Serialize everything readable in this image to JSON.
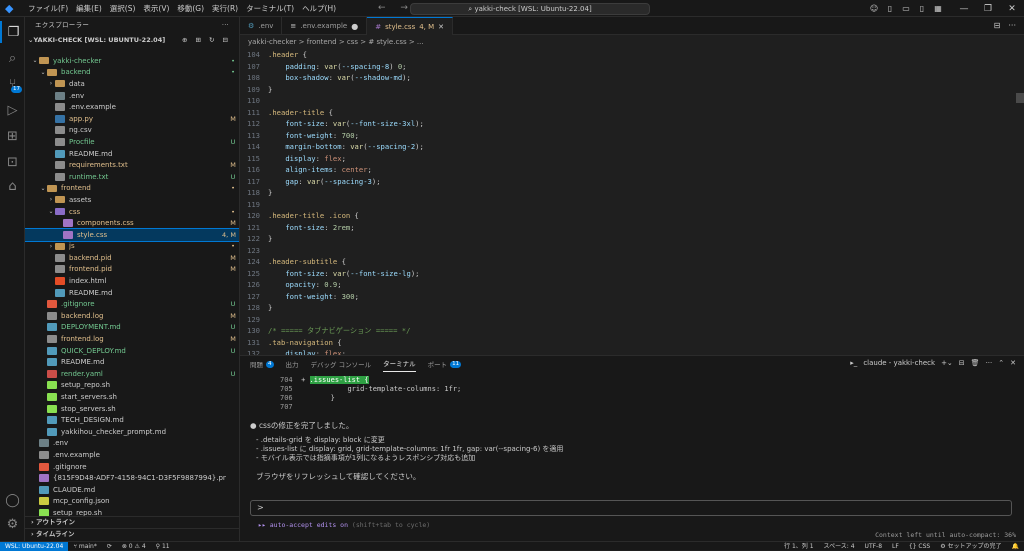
{
  "titlebar": {
    "menu": [
      "ファイル(F)",
      "編集(E)",
      "選択(S)",
      "表示(V)",
      "移動(G)",
      "実行(R)",
      "ターミナル(T)",
      "ヘルプ(H)"
    ],
    "command_center": "yakki-check [WSL: Ubuntu-22.04]"
  },
  "activity_bar": {
    "scm_badge": "17"
  },
  "sidebar": {
    "title": "エクスプローラー",
    "root": "YAKKI-CHECK [WSL: UBUNTU-22.04]",
    "tree": [
      {
        "name": "yakki-checker",
        "depth": 0,
        "chevron": "v",
        "icon": "folder",
        "status": "•",
        "cls": "green"
      },
      {
        "name": "backend",
        "depth": 1,
        "chevron": "v",
        "icon": "folder",
        "status": "•",
        "cls": "green"
      },
      {
        "name": "data",
        "depth": 2,
        "chevron": ">",
        "icon": "folder",
        "status": "",
        "cls": ""
      },
      {
        "name": ".env",
        "depth": 2,
        "chevron": "",
        "icon": "gear",
        "status": "",
        "cls": ""
      },
      {
        "name": ".env.example",
        "depth": 2,
        "chevron": "",
        "icon": "file",
        "status": "",
        "cls": ""
      },
      {
        "name": "app.py",
        "depth": 2,
        "chevron": "",
        "icon": "py",
        "status": "M",
        "cls": "yellow"
      },
      {
        "name": "ng.csv",
        "depth": 2,
        "chevron": "",
        "icon": "file",
        "status": "",
        "cls": ""
      },
      {
        "name": "Procfile",
        "depth": 2,
        "chevron": "",
        "icon": "file",
        "status": "U",
        "cls": "green"
      },
      {
        "name": "README.md",
        "depth": 2,
        "chevron": "",
        "icon": "md",
        "status": "",
        "cls": ""
      },
      {
        "name": "requirements.txt",
        "depth": 2,
        "chevron": "",
        "icon": "txt",
        "status": "M",
        "cls": "yellow"
      },
      {
        "name": "runtime.txt",
        "depth": 2,
        "chevron": "",
        "icon": "txt",
        "status": "U",
        "cls": "green"
      },
      {
        "name": "frontend",
        "depth": 1,
        "chevron": "v",
        "icon": "folder",
        "status": "•",
        "cls": "yellow"
      },
      {
        "name": "assets",
        "depth": 2,
        "chevron": ">",
        "icon": "folder",
        "status": "",
        "cls": ""
      },
      {
        "name": "css",
        "depth": 2,
        "chevron": "v",
        "icon": "folder-css",
        "status": "•",
        "cls": "yellow"
      },
      {
        "name": "components.css",
        "depth": 3,
        "chevron": "",
        "icon": "css",
        "status": "M",
        "cls": "yellow"
      },
      {
        "name": "style.css",
        "depth": 3,
        "chevron": "",
        "icon": "css",
        "status": "4, M",
        "cls": "yellow",
        "selected": true
      },
      {
        "name": "js",
        "depth": 2,
        "chevron": ">",
        "icon": "folder",
        "status": "•",
        "cls": "yellow"
      },
      {
        "name": "backend.pid",
        "depth": 2,
        "chevron": "",
        "icon": "file",
        "status": "M",
        "cls": "yellow"
      },
      {
        "name": "frontend.pid",
        "depth": 2,
        "chevron": "",
        "icon": "file",
        "status": "M",
        "cls": "yellow"
      },
      {
        "name": "index.html",
        "depth": 2,
        "chevron": "",
        "icon": "html",
        "status": "",
        "cls": ""
      },
      {
        "name": "README.md",
        "depth": 2,
        "chevron": "",
        "icon": "md",
        "status": "",
        "cls": ""
      },
      {
        "name": ".gitignore",
        "depth": 1,
        "chevron": "",
        "icon": "git",
        "status": "U",
        "cls": "green"
      },
      {
        "name": "backend.log",
        "depth": 1,
        "chevron": "",
        "icon": "log",
        "status": "M",
        "cls": "yellow"
      },
      {
        "name": "DEPLOYMENT.md",
        "depth": 1,
        "chevron": "",
        "icon": "md",
        "status": "U",
        "cls": "green"
      },
      {
        "name": "frontend.log",
        "depth": 1,
        "chevron": "",
        "icon": "log",
        "status": "M",
        "cls": "yellow"
      },
      {
        "name": "QUICK_DEPLOY.md",
        "depth": 1,
        "chevron": "",
        "icon": "md",
        "status": "U",
        "cls": "green"
      },
      {
        "name": "README.md",
        "depth": 1,
        "chevron": "",
        "icon": "md",
        "status": "",
        "cls": ""
      },
      {
        "name": "render.yaml",
        "depth": 1,
        "chevron": "",
        "icon": "yaml",
        "status": "U",
        "cls": "green"
      },
      {
        "name": "setup_repo.sh",
        "depth": 1,
        "chevron": "",
        "icon": "sh",
        "status": "",
        "cls": ""
      },
      {
        "name": "start_servers.sh",
        "depth": 1,
        "chevron": "",
        "icon": "sh",
        "status": "",
        "cls": ""
      },
      {
        "name": "stop_servers.sh",
        "depth": 1,
        "chevron": "",
        "icon": "sh",
        "status": "",
        "cls": ""
      },
      {
        "name": "TECH_DESIGN.md",
        "depth": 1,
        "chevron": "",
        "icon": "md",
        "status": "",
        "cls": ""
      },
      {
        "name": "yakkihou_checker_prompt.md",
        "depth": 1,
        "chevron": "",
        "icon": "md",
        "status": "",
        "cls": ""
      },
      {
        "name": ".env",
        "depth": 0,
        "chevron": "",
        "icon": "gear",
        "status": "",
        "cls": ""
      },
      {
        "name": ".env.example",
        "depth": 0,
        "chevron": "",
        "icon": "file",
        "status": "",
        "cls": ""
      },
      {
        "name": ".gitignore",
        "depth": 0,
        "chevron": "",
        "icon": "git",
        "status": "",
        "cls": ""
      },
      {
        "name": "{815F9D48-ADF7-4158-94C1-D3F5F9887994}.png",
        "depth": 0,
        "chevron": "",
        "icon": "img",
        "status": "",
        "cls": ""
      },
      {
        "name": "CLAUDE.md",
        "depth": 0,
        "chevron": "",
        "icon": "md",
        "status": "",
        "cls": ""
      },
      {
        "name": "mcp_config.json",
        "depth": 0,
        "chevron": "",
        "icon": "json",
        "status": "",
        "cls": ""
      },
      {
        "name": "setup_repo.sh",
        "depth": 0,
        "chevron": "",
        "icon": "sh",
        "status": "",
        "cls": ""
      }
    ],
    "outline_label": "アウトライン",
    "timeline_label": "タイムライン"
  },
  "tabs": [
    {
      "label": ".env",
      "icon": "⚙",
      "active": false,
      "mod": "",
      "cls": ""
    },
    {
      "label": ".env.example",
      "icon": "≡",
      "active": false,
      "mod": "●",
      "cls": ""
    },
    {
      "label": "style.css",
      "badge": "4, M",
      "icon": "#",
      "active": true,
      "mod": "",
      "cls": ""
    }
  ],
  "breadcrumb": "yakki-checker > frontend > css > # style.css > ...",
  "code_lines": [
    {
      "n": "104",
      "t": [
        [
          "sel-c",
          ".header"
        ],
        [
          "pun",
          " {"
        ]
      ]
    },
    {
      "n": "107",
      "t": [
        [
          "pun",
          "    "
        ],
        [
          "prop",
          "padding"
        ],
        [
          "pun",
          ": "
        ],
        [
          "fn",
          "var"
        ],
        [
          "pun",
          "("
        ],
        [
          "var",
          "--spacing-8"
        ],
        [
          "pun",
          ") "
        ],
        [
          "num",
          "0"
        ],
        [
          "pun",
          ";"
        ]
      ]
    },
    {
      "n": "108",
      "t": [
        [
          "pun",
          "    "
        ],
        [
          "prop",
          "box-shadow"
        ],
        [
          "pun",
          ": "
        ],
        [
          "fn",
          "var"
        ],
        [
          "pun",
          "("
        ],
        [
          "var",
          "--shadow-md"
        ],
        [
          "pun",
          ");"
        ]
      ]
    },
    {
      "n": "109",
      "t": [
        [
          "pun",
          "}"
        ]
      ]
    },
    {
      "n": "110",
      "t": []
    },
    {
      "n": "111",
      "t": [
        [
          "sel-c",
          ".header-title"
        ],
        [
          "pun",
          " {"
        ]
      ]
    },
    {
      "n": "112",
      "t": [
        [
          "pun",
          "    "
        ],
        [
          "prop",
          "font-size"
        ],
        [
          "pun",
          ": "
        ],
        [
          "fn",
          "var"
        ],
        [
          "pun",
          "("
        ],
        [
          "var",
          "--font-size-3xl"
        ],
        [
          "pun",
          ");"
        ]
      ]
    },
    {
      "n": "113",
      "t": [
        [
          "pun",
          "    "
        ],
        [
          "prop",
          "font-weight"
        ],
        [
          "pun",
          ": "
        ],
        [
          "num",
          "700"
        ],
        [
          "pun",
          ";"
        ]
      ]
    },
    {
      "n": "114",
      "t": [
        [
          "pun",
          "    "
        ],
        [
          "prop",
          "margin-bottom"
        ],
        [
          "pun",
          ": "
        ],
        [
          "fn",
          "var"
        ],
        [
          "pun",
          "("
        ],
        [
          "var",
          "--spacing-2"
        ],
        [
          "pun",
          ");"
        ]
      ]
    },
    {
      "n": "115",
      "t": [
        [
          "pun",
          "    "
        ],
        [
          "prop",
          "display"
        ],
        [
          "pun",
          ": "
        ],
        [
          "val",
          "flex"
        ],
        [
          "pun",
          ";"
        ]
      ]
    },
    {
      "n": "116",
      "t": [
        [
          "pun",
          "    "
        ],
        [
          "prop",
          "align-items"
        ],
        [
          "pun",
          ": "
        ],
        [
          "val",
          "center"
        ],
        [
          "pun",
          ";"
        ]
      ]
    },
    {
      "n": "117",
      "t": [
        [
          "pun",
          "    "
        ],
        [
          "prop",
          "gap"
        ],
        [
          "pun",
          ": "
        ],
        [
          "fn",
          "var"
        ],
        [
          "pun",
          "("
        ],
        [
          "var",
          "--spacing-3"
        ],
        [
          "pun",
          ");"
        ]
      ]
    },
    {
      "n": "118",
      "t": [
        [
          "pun",
          "}"
        ]
      ]
    },
    {
      "n": "119",
      "t": []
    },
    {
      "n": "120",
      "t": [
        [
          "sel-c",
          ".header-title .icon"
        ],
        [
          "pun",
          " {"
        ]
      ]
    },
    {
      "n": "121",
      "t": [
        [
          "pun",
          "    "
        ],
        [
          "prop",
          "font-size"
        ],
        [
          "pun",
          ": "
        ],
        [
          "num",
          "2rem"
        ],
        [
          "pun",
          ";"
        ]
      ]
    },
    {
      "n": "122",
      "t": [
        [
          "pun",
          "}"
        ]
      ]
    },
    {
      "n": "123",
      "t": []
    },
    {
      "n": "124",
      "t": [
        [
          "sel-c",
          ".header-subtitle"
        ],
        [
          "pun",
          " {"
        ]
      ]
    },
    {
      "n": "125",
      "t": [
        [
          "pun",
          "    "
        ],
        [
          "prop",
          "font-size"
        ],
        [
          "pun",
          ": "
        ],
        [
          "fn",
          "var"
        ],
        [
          "pun",
          "("
        ],
        [
          "var",
          "--font-size-lg"
        ],
        [
          "pun",
          ");"
        ]
      ]
    },
    {
      "n": "126",
      "t": [
        [
          "pun",
          "    "
        ],
        [
          "prop",
          "opacity"
        ],
        [
          "pun",
          ": "
        ],
        [
          "num",
          "0.9"
        ],
        [
          "pun",
          ";"
        ]
      ]
    },
    {
      "n": "127",
      "t": [
        [
          "pun",
          "    "
        ],
        [
          "prop",
          "font-weight"
        ],
        [
          "pun",
          ": "
        ],
        [
          "num",
          "300"
        ],
        [
          "pun",
          ";"
        ]
      ]
    },
    {
      "n": "128",
      "t": [
        [
          "pun",
          "}"
        ]
      ]
    },
    {
      "n": "129",
      "t": []
    },
    {
      "n": "130",
      "t": [
        [
          "cm",
          "/* ===== タブナビゲーション ===== */"
        ]
      ]
    },
    {
      "n": "131",
      "t": [
        [
          "sel-c",
          ".tab-navigation"
        ],
        [
          "pun",
          " {"
        ]
      ]
    },
    {
      "n": "132",
      "t": [
        [
          "pun",
          "    "
        ],
        [
          "prop",
          "display"
        ],
        [
          "pun",
          ": "
        ],
        [
          "val",
          "flex"
        ],
        [
          "pun",
          ";"
        ]
      ]
    },
    {
      "n": "133",
      "t": [
        [
          "pun",
          "    "
        ],
        [
          "prop",
          "gap"
        ],
        [
          "pun",
          ": "
        ],
        [
          "fn",
          "var"
        ],
        [
          "pun",
          "("
        ],
        [
          "var",
          "--spacing-1"
        ],
        [
          "pun",
          ");"
        ]
      ]
    },
    {
      "n": "134",
      "t": [
        [
          "pun",
          "    "
        ],
        [
          "prop",
          "margin-bottom"
        ],
        [
          "pun",
          ": "
        ],
        [
          "fn",
          "var"
        ],
        [
          "pun",
          "("
        ],
        [
          "var",
          "--spacing-6"
        ],
        [
          "pun",
          ");"
        ]
      ]
    },
    {
      "n": "135",
      "t": [
        [
          "pun",
          "    "
        ],
        [
          "prop",
          "background-color"
        ],
        [
          "pun",
          ": "
        ],
        [
          "pun",
          "□"
        ],
        [
          "val",
          "white"
        ],
        [
          "pun",
          ";"
        ]
      ]
    }
  ],
  "panel": {
    "tabs": [
      {
        "label": "問題",
        "badge": "4"
      },
      {
        "label": "出力",
        "badge": ""
      },
      {
        "label": "デバッグ コンソール",
        "badge": ""
      },
      {
        "label": "ターミナル",
        "badge": "",
        "active": true
      },
      {
        "label": "ポート",
        "badge": "11"
      }
    ],
    "terminal_name": "claude - yakki-check",
    "terminal_lines": [
      {
        "n": "704",
        "pre": " + ",
        "hl": ".issues-list {",
        "post": ""
      },
      {
        "n": "705",
        "pre": "            ",
        "hl": "",
        "post": "grid-template-columns: 1fr;"
      },
      {
        "n": "706",
        "pre": "        ",
        "hl": "",
        "post": "}"
      },
      {
        "n": "707",
        "pre": "",
        "hl": "",
        "post": ""
      }
    ],
    "done_msg": "cssの修正を完了しました。",
    "bullets": [
      "- .details-grid を display: block に変更",
      "- .issues-list に display: grid, grid-template-columns: 1fr 1fr, gap: var(--spacing-6) を適用",
      "- モバイル表示では指摘事項が1列になるようレスポンシブ対応も追加"
    ],
    "refresh_msg": "ブラウザをリフレッシュして確認してください。",
    "prompt": ">",
    "auto_accept": "▸▸ auto-accept edits on",
    "auto_accept_hint": " (shift+tab to cycle)",
    "context": "Context left until auto-compact: 36%"
  },
  "statusbar": {
    "remote": "WSL: Ubuntu-22.04",
    "branch": "main*",
    "sync": "⟳",
    "problems": "⊗ 0 ⚠ 4",
    "ports": "11",
    "position": "行 1、列 1",
    "spaces": "スペース: 4",
    "encoding": "UTF-8",
    "eol": "LF",
    "lang": "{} CSS",
    "extra": "セットアップの完了"
  }
}
